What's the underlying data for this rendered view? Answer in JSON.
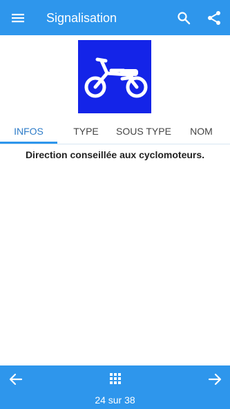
{
  "app": {
    "title": "Signalisation"
  },
  "sign": {
    "description_icon": "moped-icon",
    "background": "#1424e8"
  },
  "tabs": [
    {
      "label": "INFOS",
      "active": true
    },
    {
      "label": "TYPE"
    },
    {
      "label": "SOUS TYPE"
    },
    {
      "label": "NOM"
    }
  ],
  "content": {
    "description": "Direction conseillée aux cyclomoteurs."
  },
  "navigation": {
    "counter": "24 sur 38"
  },
  "colors": {
    "primary": "#2e96ec",
    "accent": "#2e7cc8",
    "sign_blue": "#1424e8"
  }
}
